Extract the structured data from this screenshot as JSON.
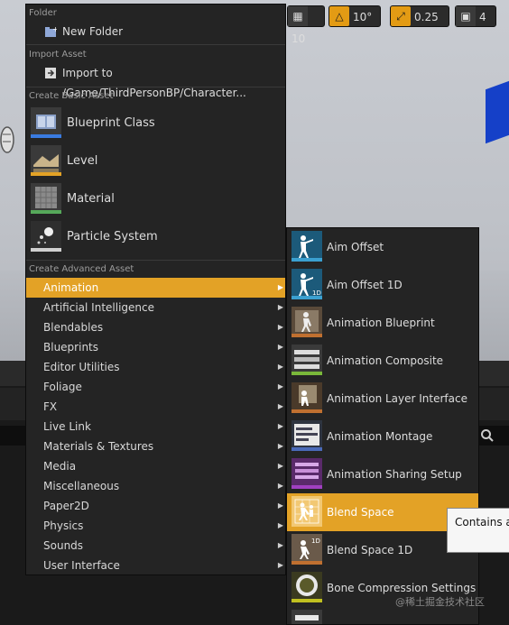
{
  "toolbar": {
    "grid_value": "10",
    "rotation_value": "10°",
    "scale_value": "0.25",
    "camera_speed": "4"
  },
  "menu": {
    "folder_header": "Folder",
    "new_folder": "New Folder",
    "import_header": "Import Asset",
    "import_item": "Import to /Game/ThirdPersonBP/Character...",
    "basic_header": "Create Basic Asset",
    "basic_items": [
      {
        "label": "Blueprint Class",
        "icon": "blueprint-class-icon",
        "bar_color": "#3a7be0"
      },
      {
        "label": "Level",
        "icon": "level-icon",
        "bar_color": "#e3a226"
      },
      {
        "label": "Material",
        "icon": "material-icon",
        "bar_color": "#56a85a"
      },
      {
        "label": "Particle System",
        "icon": "particle-system-icon",
        "bar_color": "#d0d0d0"
      }
    ],
    "advanced_header": "Create Advanced Asset",
    "advanced_items": [
      "Animation",
      "Artificial Intelligence",
      "Blendables",
      "Blueprints",
      "Editor Utilities",
      "Foliage",
      "FX",
      "Live Link",
      "Materials & Textures",
      "Media",
      "Miscellaneous",
      "Paper2D",
      "Physics",
      "Sounds",
      "User Interface"
    ],
    "highlighted_index": 0,
    "highlight_color": "#e3a226"
  },
  "submenu": {
    "items": [
      {
        "label": "Aim Offset",
        "icon": "aim-offset-icon",
        "badge": ""
      },
      {
        "label": "Aim Offset 1D",
        "icon": "aim-offset-1d-icon",
        "badge": "1D"
      },
      {
        "label": "Animation Blueprint",
        "icon": "animation-blueprint-icon",
        "badge": ""
      },
      {
        "label": "Animation Composite",
        "icon": "animation-composite-icon",
        "badge": ""
      },
      {
        "label": "Animation Layer Interface",
        "icon": "animation-layer-interface-icon",
        "badge": ""
      },
      {
        "label": "Animation Montage",
        "icon": "animation-montage-icon",
        "badge": ""
      },
      {
        "label": "Animation Sharing Setup",
        "icon": "animation-sharing-setup-icon",
        "badge": ""
      },
      {
        "label": "Blend Space",
        "icon": "blend-space-icon",
        "badge": ""
      },
      {
        "label": "Blend Space 1D",
        "icon": "blend-space-1d-icon",
        "badge": "1D"
      },
      {
        "label": "Bone Compression Settings",
        "icon": "bone-compression-settings-icon",
        "badge": ""
      },
      {
        "label": "",
        "icon": "curve-compression-icon",
        "badge": ""
      }
    ],
    "highlighted_index": 7
  },
  "tooltip": {
    "text": "Contains a"
  },
  "watermark": "@稀土掘金技术社区"
}
